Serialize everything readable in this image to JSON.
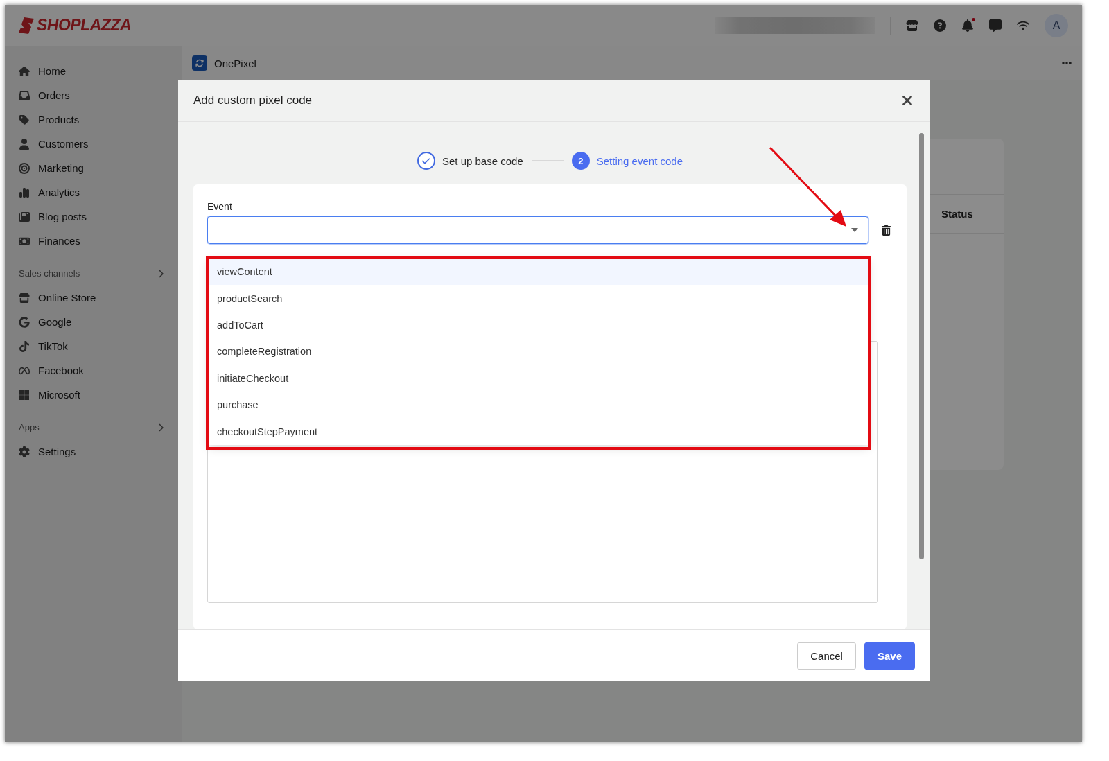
{
  "topbar": {
    "logo": "SHOPLAZZA",
    "avatar": "A"
  },
  "sidebar": {
    "items": [
      {
        "kind": "link",
        "label": "Home"
      },
      {
        "kind": "link",
        "label": "Orders"
      },
      {
        "kind": "link",
        "label": "Products"
      },
      {
        "kind": "link",
        "label": "Customers"
      },
      {
        "kind": "link",
        "label": "Marketing"
      },
      {
        "kind": "link",
        "label": "Analytics"
      },
      {
        "kind": "link",
        "label": "Blog posts"
      },
      {
        "kind": "link",
        "label": "Finances"
      },
      {
        "kind": "heading",
        "label": "Sales channels"
      },
      {
        "kind": "link",
        "label": "Online Store"
      },
      {
        "kind": "link",
        "label": "Google"
      },
      {
        "kind": "link",
        "label": "TikTok"
      },
      {
        "kind": "link",
        "label": "Facebook"
      },
      {
        "kind": "link",
        "label": "Microsoft"
      },
      {
        "kind": "heading",
        "label": "Apps"
      },
      {
        "kind": "link",
        "label": "Settings"
      }
    ]
  },
  "page_header": {
    "app_name": "OnePixel"
  },
  "background_table": {
    "columns": [
      "Status"
    ]
  },
  "dialog": {
    "title": "Add custom pixel code",
    "steps": [
      {
        "label": "Set up base code",
        "completed": true,
        "selected": false
      },
      {
        "label": "Setting event code",
        "number": "2",
        "completed": false,
        "selected": true
      }
    ],
    "event_field": {
      "label": "Event",
      "expanded": true
    },
    "options": [
      {
        "label": "viewContent",
        "selected": true
      },
      {
        "label": "productSearch",
        "selected": false
      },
      {
        "label": "addToCart",
        "selected": false
      },
      {
        "label": "completeRegistration",
        "selected": false
      },
      {
        "label": "initiateCheckout",
        "selected": false
      },
      {
        "label": "purchase",
        "selected": false
      },
      {
        "label": "checkoutStepPayment",
        "selected": false
      }
    ],
    "buttons": [
      {
        "label": "Cancel",
        "kind": "secondary"
      },
      {
        "label": "Save",
        "kind": "primary"
      }
    ]
  }
}
